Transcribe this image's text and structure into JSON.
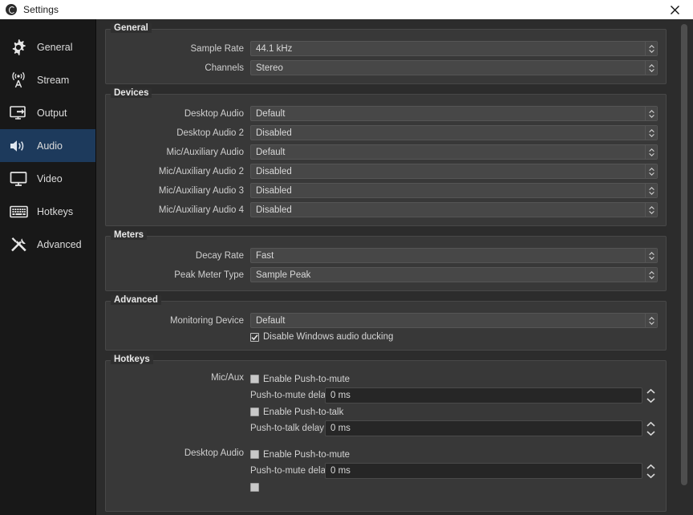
{
  "titlebar": {
    "app_icon": "obs-logo-icon",
    "title": "Settings",
    "close_icon": "close-icon"
  },
  "sidebar": {
    "items": [
      {
        "label": "General",
        "icon": "gear-icon",
        "selected": false
      },
      {
        "label": "Stream",
        "icon": "antenna-icon",
        "selected": false
      },
      {
        "label": "Output",
        "icon": "output-icon",
        "selected": false
      },
      {
        "label": "Audio",
        "icon": "speaker-icon",
        "selected": true
      },
      {
        "label": "Video",
        "icon": "monitor-icon",
        "selected": false
      },
      {
        "label": "Hotkeys",
        "icon": "keyboard-icon",
        "selected": false
      },
      {
        "label": "Advanced",
        "icon": "tools-icon",
        "selected": false
      }
    ],
    "selected_color": "#1d3a5c"
  },
  "sections": {
    "general": {
      "title": "General",
      "rows": [
        {
          "label": "Sample Rate",
          "value": "44.1 kHz"
        },
        {
          "label": "Channels",
          "value": "Stereo"
        }
      ]
    },
    "devices": {
      "title": "Devices",
      "rows": [
        {
          "label": "Desktop Audio",
          "value": "Default"
        },
        {
          "label": "Desktop Audio 2",
          "value": "Disabled"
        },
        {
          "label": "Mic/Auxiliary Audio",
          "value": "Default"
        },
        {
          "label": "Mic/Auxiliary Audio 2",
          "value": "Disabled"
        },
        {
          "label": "Mic/Auxiliary Audio 3",
          "value": "Disabled"
        },
        {
          "label": "Mic/Auxiliary Audio 4",
          "value": "Disabled"
        }
      ]
    },
    "meters": {
      "title": "Meters",
      "rows": [
        {
          "label": "Decay Rate",
          "value": "Fast"
        },
        {
          "label": "Peak Meter Type",
          "value": "Sample Peak"
        }
      ]
    },
    "advanced": {
      "title": "Advanced",
      "rows": [
        {
          "label": "Monitoring Device",
          "value": "Default"
        }
      ],
      "checkbox": {
        "label": "Disable Windows audio ducking",
        "checked": true
      }
    },
    "hotkeys": {
      "title": "Hotkeys",
      "blocks": [
        {
          "head": "Mic/Aux",
          "push_to_mute": {
            "label": "Enable Push-to-mute",
            "checked": false
          },
          "push_to_mute_delay": {
            "label": "Push-to-mute delay",
            "value": "0 ms"
          },
          "push_to_talk": {
            "label": "Enable Push-to-talk",
            "checked": false
          },
          "push_to_talk_delay": {
            "label": "Push-to-talk delay",
            "value": "0 ms"
          }
        },
        {
          "head": "Desktop Audio",
          "push_to_mute": {
            "label": "Enable Push-to-mute",
            "checked": false
          },
          "push_to_mute_delay": {
            "label": "Push-to-mute delay",
            "value": "0 ms"
          }
        }
      ]
    }
  },
  "scrollbar": {
    "name": "vertical-scrollbar"
  }
}
